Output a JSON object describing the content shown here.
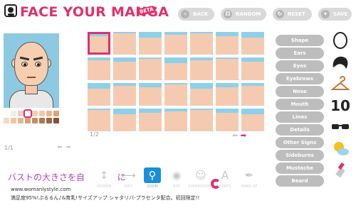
{
  "header": {
    "title": "FACE YOUR MANGA",
    "badge": "BETA",
    "buttons": {
      "back": "BACK",
      "random": "RANDOM",
      "reset": "RESET",
      "save": "SAVE"
    }
  },
  "preview": {
    "skin_swatches": [
      "#ffffff",
      "#eeeeee",
      "#e8d2c0",
      "#ffffff",
      "#f2cdb0",
      "#f3c7a8",
      "#e6b890",
      "#d8a37c",
      "#f6d9c3",
      "#f0c7a5",
      "#e3b793",
      "#d4a27a",
      "#c58d63",
      "#b07752",
      "#9c6545",
      "#845236"
    ],
    "selected_swatch_index": 3,
    "pager": "1/1"
  },
  "grid": {
    "pager": "1/2",
    "selected_index": 0,
    "accent": "#e0306e",
    "cell_bg": "#8ed0ea"
  },
  "categories": [
    "Shape",
    "Ears",
    "Eyes",
    "Eyebrows",
    "Nose",
    "Mouth",
    "Lines",
    "Details",
    "Other Signs",
    "Sideburns",
    "Mustache",
    "Beard"
  ],
  "side_icons": [
    "face-shape-icon",
    "hair-icon",
    "hanger-icon",
    "number-10-icon",
    "sunglasses-icon",
    "sun-cloud-icon",
    "lipstick-icon"
  ],
  "side_text": {
    "number": "10"
  },
  "ad": {
    "title": "バストの大きさを自",
    "title_tail": "に",
    "url": "www.womanlystyle.com",
    "desc": "満足度95%!ぷるるん♪&育乳!サイズアップ シャタリバ-プラセンタ配合。初回限定!!"
  },
  "tools": [
    {
      "label": "UP/DWN",
      "icon": "up-down-icon"
    },
    {
      "label": "DIST",
      "icon": "distance-icon"
    },
    {
      "label": "ZOOM",
      "icon": "zoom-icon"
    },
    {
      "label": "EYE",
      "icon": "eye-icon"
    },
    {
      "label": "EXPRESSIONS",
      "icon": "expressions-icon"
    },
    {
      "label": "FONTS",
      "icon": "font-icon"
    },
    {
      "label": "MAKE-UP",
      "icon": "makeup-icon"
    }
  ],
  "colors": {
    "brand": "#e0306e",
    "button_gray": "#bdbdbd",
    "active_tool": "#1b8fd6"
  }
}
